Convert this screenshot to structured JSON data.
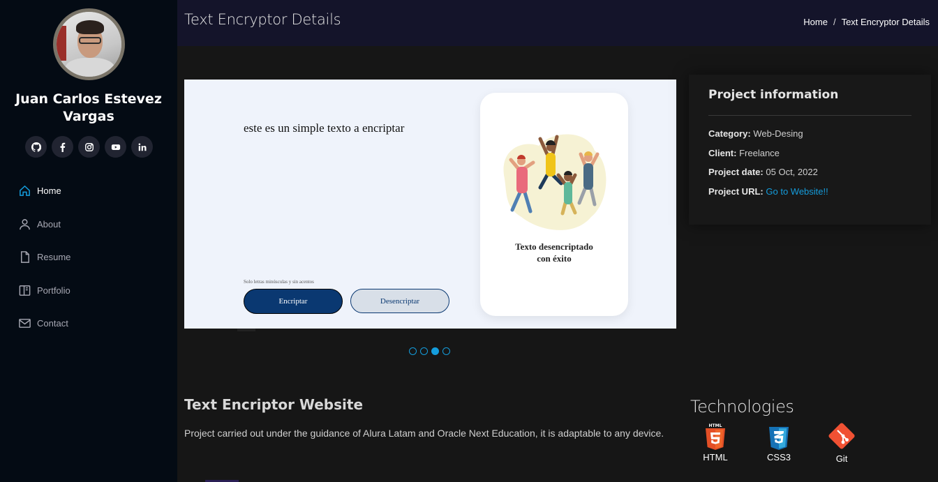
{
  "profile": {
    "name": "Juan Carlos Estevez Vargas",
    "socials": [
      "github-icon",
      "facebook-icon",
      "instagram-icon",
      "youtube-icon",
      "linkedin-icon"
    ]
  },
  "nav": {
    "items": [
      {
        "label": "Home",
        "icon": "home-icon",
        "active": true
      },
      {
        "label": "About",
        "icon": "person-icon"
      },
      {
        "label": "Resume",
        "icon": "file-icon"
      },
      {
        "label": "Portfolio",
        "icon": "book-icon"
      },
      {
        "label": "Contact",
        "icon": "envelope-icon"
      }
    ]
  },
  "header": {
    "title": "Text Encryptor Details",
    "breadcrumb": {
      "home": "Home",
      "separator": "/",
      "current": "Text Encryptor Details"
    }
  },
  "slide": {
    "sample_text": "este es un simple texto a encriptar",
    "hint": "Solo letras minúsculas y sin acentos",
    "encrypt_label": "Encriptar",
    "decrypt_label": "Desencriptar",
    "result_line1": "Texto desencriptado",
    "result_line2": "con éxito"
  },
  "carousel": {
    "count": 4,
    "active_index": 2
  },
  "project_info": {
    "title": "Project information",
    "category_label": "Category",
    "category": "Web-Desing",
    "client_label": "Client",
    "client": "Freelance",
    "date_label": "Project date",
    "date": "05 Oct, 2022",
    "url_label": "Project URL",
    "url_text": "Go to Website!!"
  },
  "description": {
    "title": "Text Encriptor Website",
    "text": "Project carried out under the guidance of Alura Latam and Oracle Next Education, it is adaptable to any device."
  },
  "technologies": {
    "title": "Technologies",
    "items": [
      {
        "label": "HTML",
        "icon": "html5-icon"
      },
      {
        "label": "CSS3",
        "icon": "css3-icon"
      },
      {
        "label": "Git",
        "icon": "git-icon"
      }
    ]
  },
  "colors": {
    "accent": "#149ddd",
    "sidebar": "#040b14",
    "button": "#0a3871"
  }
}
